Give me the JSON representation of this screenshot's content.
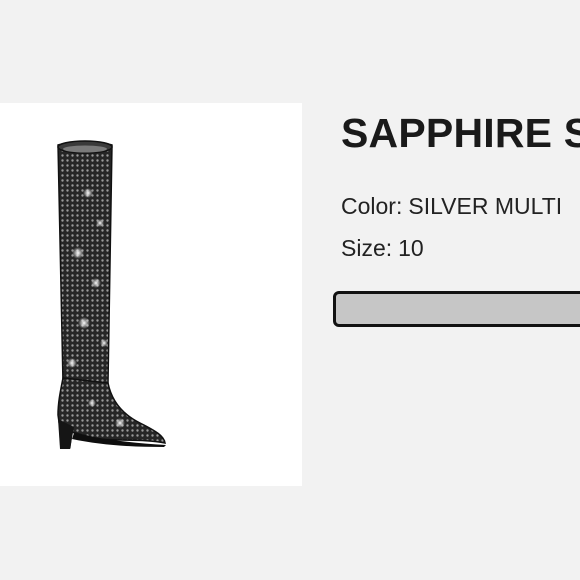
{
  "product": {
    "title": "SAPPHIRE S",
    "color_label": "Color:",
    "color_value": "SILVER MULTI",
    "size_label": "Size:",
    "size_value": "10",
    "image_icon": "boot-image"
  },
  "colors": {
    "page_background": "#f2f2f2",
    "image_panel_background": "#ffffff",
    "title_text": "#1a1a1a",
    "button_fill": "#c6c6c6",
    "button_border": "#111111",
    "boot_base": "#1c1c1c",
    "boot_sparkle": "#e8e8e8"
  }
}
